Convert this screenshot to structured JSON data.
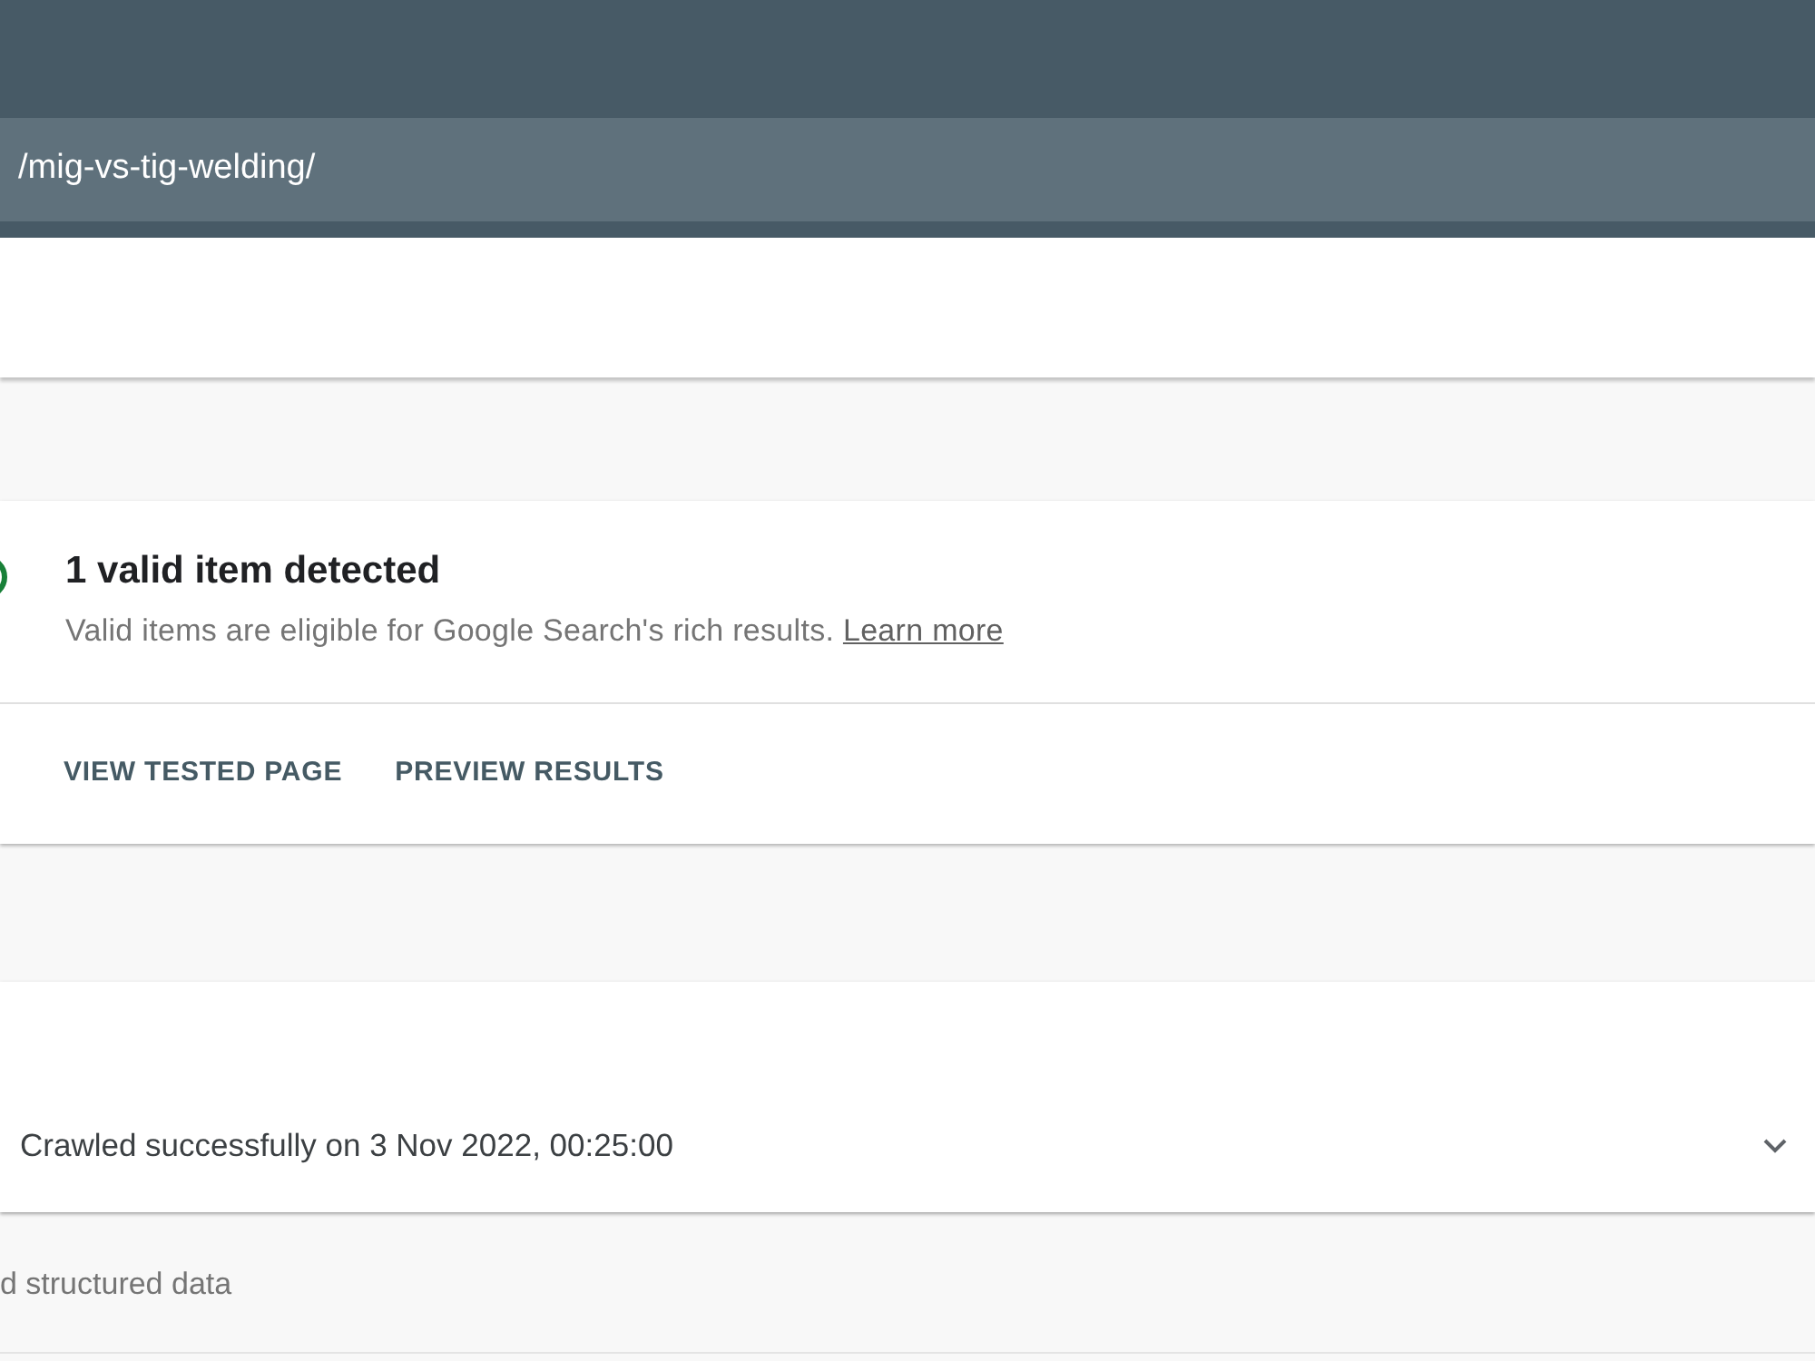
{
  "header": {
    "url": "/mig-vs-tig-welding/"
  },
  "result_card": {
    "valid": true,
    "title": "1 valid item detected",
    "description": "Valid items are eligible for Google Search's rich results.",
    "link": "Learn more",
    "actions": [
      "VIEW TESTED PAGE",
      "PREVIEW RESULTS"
    ]
  },
  "crawl_card": {
    "status_text": "Crawled successfully on 3 Nov 2022, 00:25:00",
    "expanded": false
  },
  "section": {
    "label": "d structured data"
  }
}
